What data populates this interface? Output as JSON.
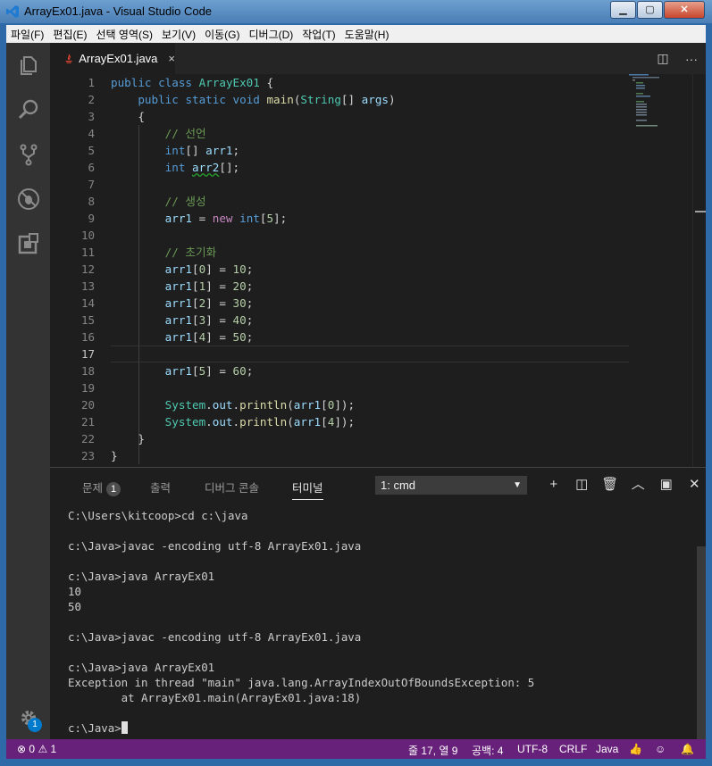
{
  "window": {
    "title": "ArrayEx01.java - Visual Studio Code",
    "minimize": "▁",
    "maximize": "▢",
    "close": "✕"
  },
  "menu": [
    "파일(F)",
    "편집(E)",
    "선택 영역(S)",
    "보기(V)",
    "이동(G)",
    "디버그(D)",
    "작업(T)",
    "도움말(H)"
  ],
  "activity_icons": [
    "explorer-icon",
    "search-icon",
    "source-control-icon",
    "debug-icon",
    "extensions-icon",
    "settings-gear-icon"
  ],
  "settings_badge": "1",
  "editor_tab": {
    "label": "ArrayEx01.java",
    "close": "×"
  },
  "tab_actions": {
    "split": "◫",
    "more": "···"
  },
  "code": {
    "line_numbers": [
      "1",
      "2",
      "3",
      "4",
      "5",
      "6",
      "7",
      "8",
      "9",
      "10",
      "11",
      "12",
      "13",
      "14",
      "15",
      "16",
      "17",
      "18",
      "19",
      "20",
      "21",
      "22",
      "23"
    ],
    "active_line": 17
  },
  "panel": {
    "tabs": [
      {
        "label": "문제",
        "badge": "1"
      },
      {
        "label": "출력"
      },
      {
        "label": "디버그 콘솔"
      },
      {
        "label": "터미널",
        "active": true
      }
    ],
    "terminal_select": "1: cmd",
    "actions": [
      "+",
      "◫",
      "🗑",
      "︿",
      "▣",
      "✕"
    ]
  },
  "terminal": [
    "C:\\Users\\kitcoop>cd c:\\java",
    "",
    "c:\\Java>javac -encoding utf-8 ArrayEx01.java",
    "",
    "c:\\Java>java ArrayEx01",
    "10",
    "50",
    "",
    "c:\\Java>javac -encoding utf-8 ArrayEx01.java",
    "",
    "c:\\Java>java ArrayEx01",
    "Exception in thread \"main\" java.lang.ArrayIndexOutOfBoundsException: 5",
    "        at ArrayEx01.main(ArrayEx01.java:18)",
    "",
    "c:\\Java>"
  ],
  "status": {
    "errors": "0",
    "warnings": "1",
    "position": "줄 17, 열 9",
    "spaces": "공백: 4",
    "encoding": "UTF-8",
    "eol": "CRLF",
    "language": "Java"
  },
  "colors": {
    "status_bar": "#68217a",
    "editor_bg": "#1e1e1e",
    "activity_bar": "#333333"
  }
}
